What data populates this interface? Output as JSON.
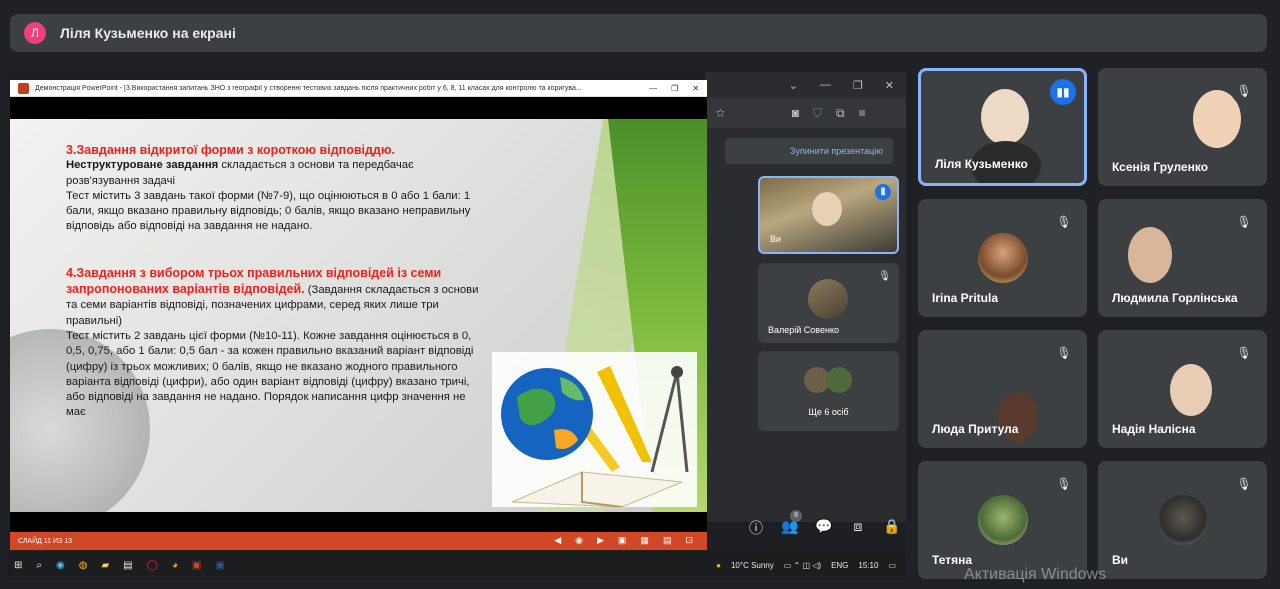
{
  "banner": {
    "avatar_letter": "Л",
    "presenting_text": "Ліля Кузьменко на екрані"
  },
  "browser": {
    "stop_label": "Зупинити презентацію"
  },
  "mini_tiles": [
    {
      "name": "Ви"
    },
    {
      "name": "Валерій Совенко"
    },
    {
      "name": "Ще 6 осіб"
    }
  ],
  "controls": {
    "people_count": "9"
  },
  "ppt": {
    "window_title": "Демонстрація PowerPoint - [3.Використання запитань ЗНО з географії у створенні тестових завдань після практичних робіт у 6, 8, 11 класах для контролю та коригува...",
    "status_text": "СЛАЙД 11 ИЗ 13",
    "slide": {
      "h1": "3.Завдання відкритої форми з короткою відповіддю.",
      "p1_bold": "Неструктуроване завдання",
      "p1_rest": " складається з основи та передбачає розв'язування задачі",
      "p2": "Тест містить 3 завдань такої форми (№7-9), що оцінюються в 0 або 1 бали: 1 бали, якщо вказано правильну відповідь; 0 балів, якщо вказано неправильну відповідь або відповіді на завдання не надано.",
      "h2": "4.Завдання з вибором трьох правильних відповідей із семи запропонованих варіантів відповідей.",
      "h2_rest": " (Завдання складається з основи та семи варіантів відповіді, позначених цифрами, серед яких лише три правильні)",
      "p3": "Тест містить 2 завдань цієї форми (№10-11). Кожне завдання оцінюється в 0, 0,5, 0,75, або 1 бали: 0,5 бал - за кожен правильно вказаний варіант відповіді (цифру) із трьох можливих; 0 балів, якщо не вказано жодного правильного варіанта відповіді (цифри), або один варіант відповіді (цифру) вказано тричі, або відповіді на завдання не надано. Порядок написання цифр значення не має"
    }
  },
  "gallery": [
    {
      "name": "Ліля Кузьменко"
    },
    {
      "name": "Ксенія Груленко"
    },
    {
      "name": "Irina Pritula"
    },
    {
      "name": "Людмила Горлінська"
    },
    {
      "name": "Люда Притула"
    },
    {
      "name": "Надія Налісна"
    },
    {
      "name": "Тетяна"
    },
    {
      "name": "Ви"
    }
  ],
  "taskbar": {
    "weather": "10°C  Sunny",
    "lang": "ENG",
    "time": "15:10"
  },
  "watermark": "Активація Windows"
}
